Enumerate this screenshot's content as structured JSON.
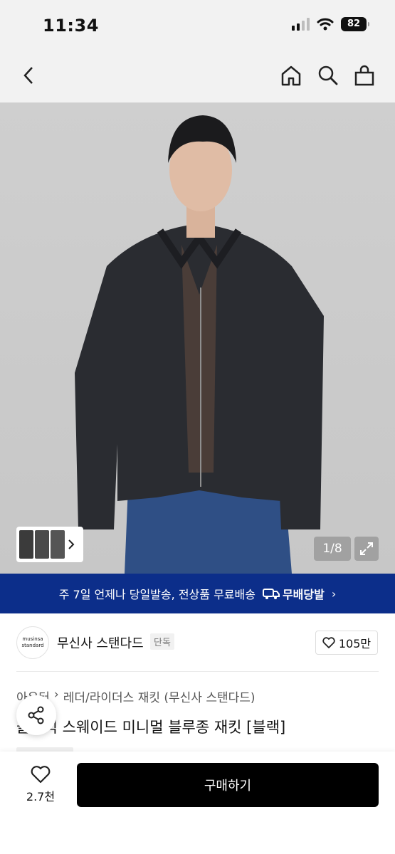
{
  "status_bar": {
    "time": "11:34",
    "battery": "82"
  },
  "gallery": {
    "page_counter": "1/8"
  },
  "promo": {
    "text": "주 7일 언제나 당일발송, 전상품 무료배송",
    "tag": "무배당발",
    "chevron": "›"
  },
  "brand": {
    "logo_line1": "musinsa",
    "logo_line2": "standard",
    "name": "무신사 스탠다드",
    "badge": "단독",
    "like_count": "105만"
  },
  "product": {
    "breadcrumb": [
      "아우터",
      "레더/라이더스 재킷 (무신사 스탠다드)"
    ],
    "title": "클래식 스웨이드 미니멀 블루종 재킷 [블랙]"
  },
  "bottom_bar": {
    "wish_count": "2.7천",
    "buy_label": "구매하기"
  },
  "colors": {
    "promo_bg": "#0c2e8a",
    "buy_bg": "#000000"
  },
  "icons": [
    "back-icon",
    "home-icon",
    "search-icon",
    "cart-icon",
    "expand-icon",
    "heart-icon",
    "share-icon",
    "delivery-icon"
  ]
}
